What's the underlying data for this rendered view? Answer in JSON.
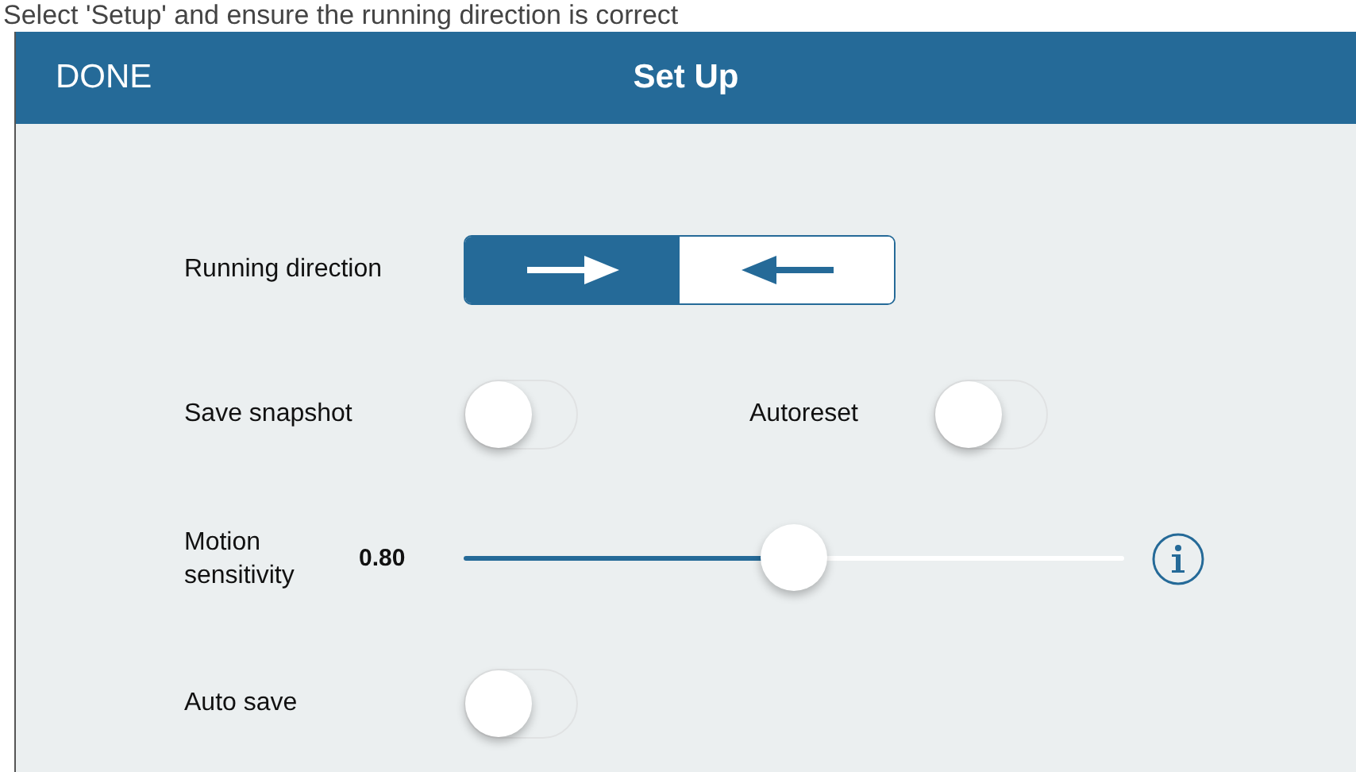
{
  "caption": "Select 'Setup' and ensure the running direction is correct",
  "nav_bar": {
    "left_button": "DONE",
    "title": "Set Up"
  },
  "running_direction": {
    "label": "Running direction",
    "options": [
      {
        "kind": "right",
        "selected": true
      },
      {
        "kind": "left",
        "selected": false
      }
    ]
  },
  "save_snapshot": {
    "label": "Save snapshot",
    "on": false
  },
  "autoreset": {
    "label": "Autoreset",
    "on": false
  },
  "motion_sensitivity": {
    "label": "Motion sensitivity",
    "value": "0.80",
    "level": 0.5
  },
  "auto_save": {
    "label": "Auto save",
    "on": false
  }
}
